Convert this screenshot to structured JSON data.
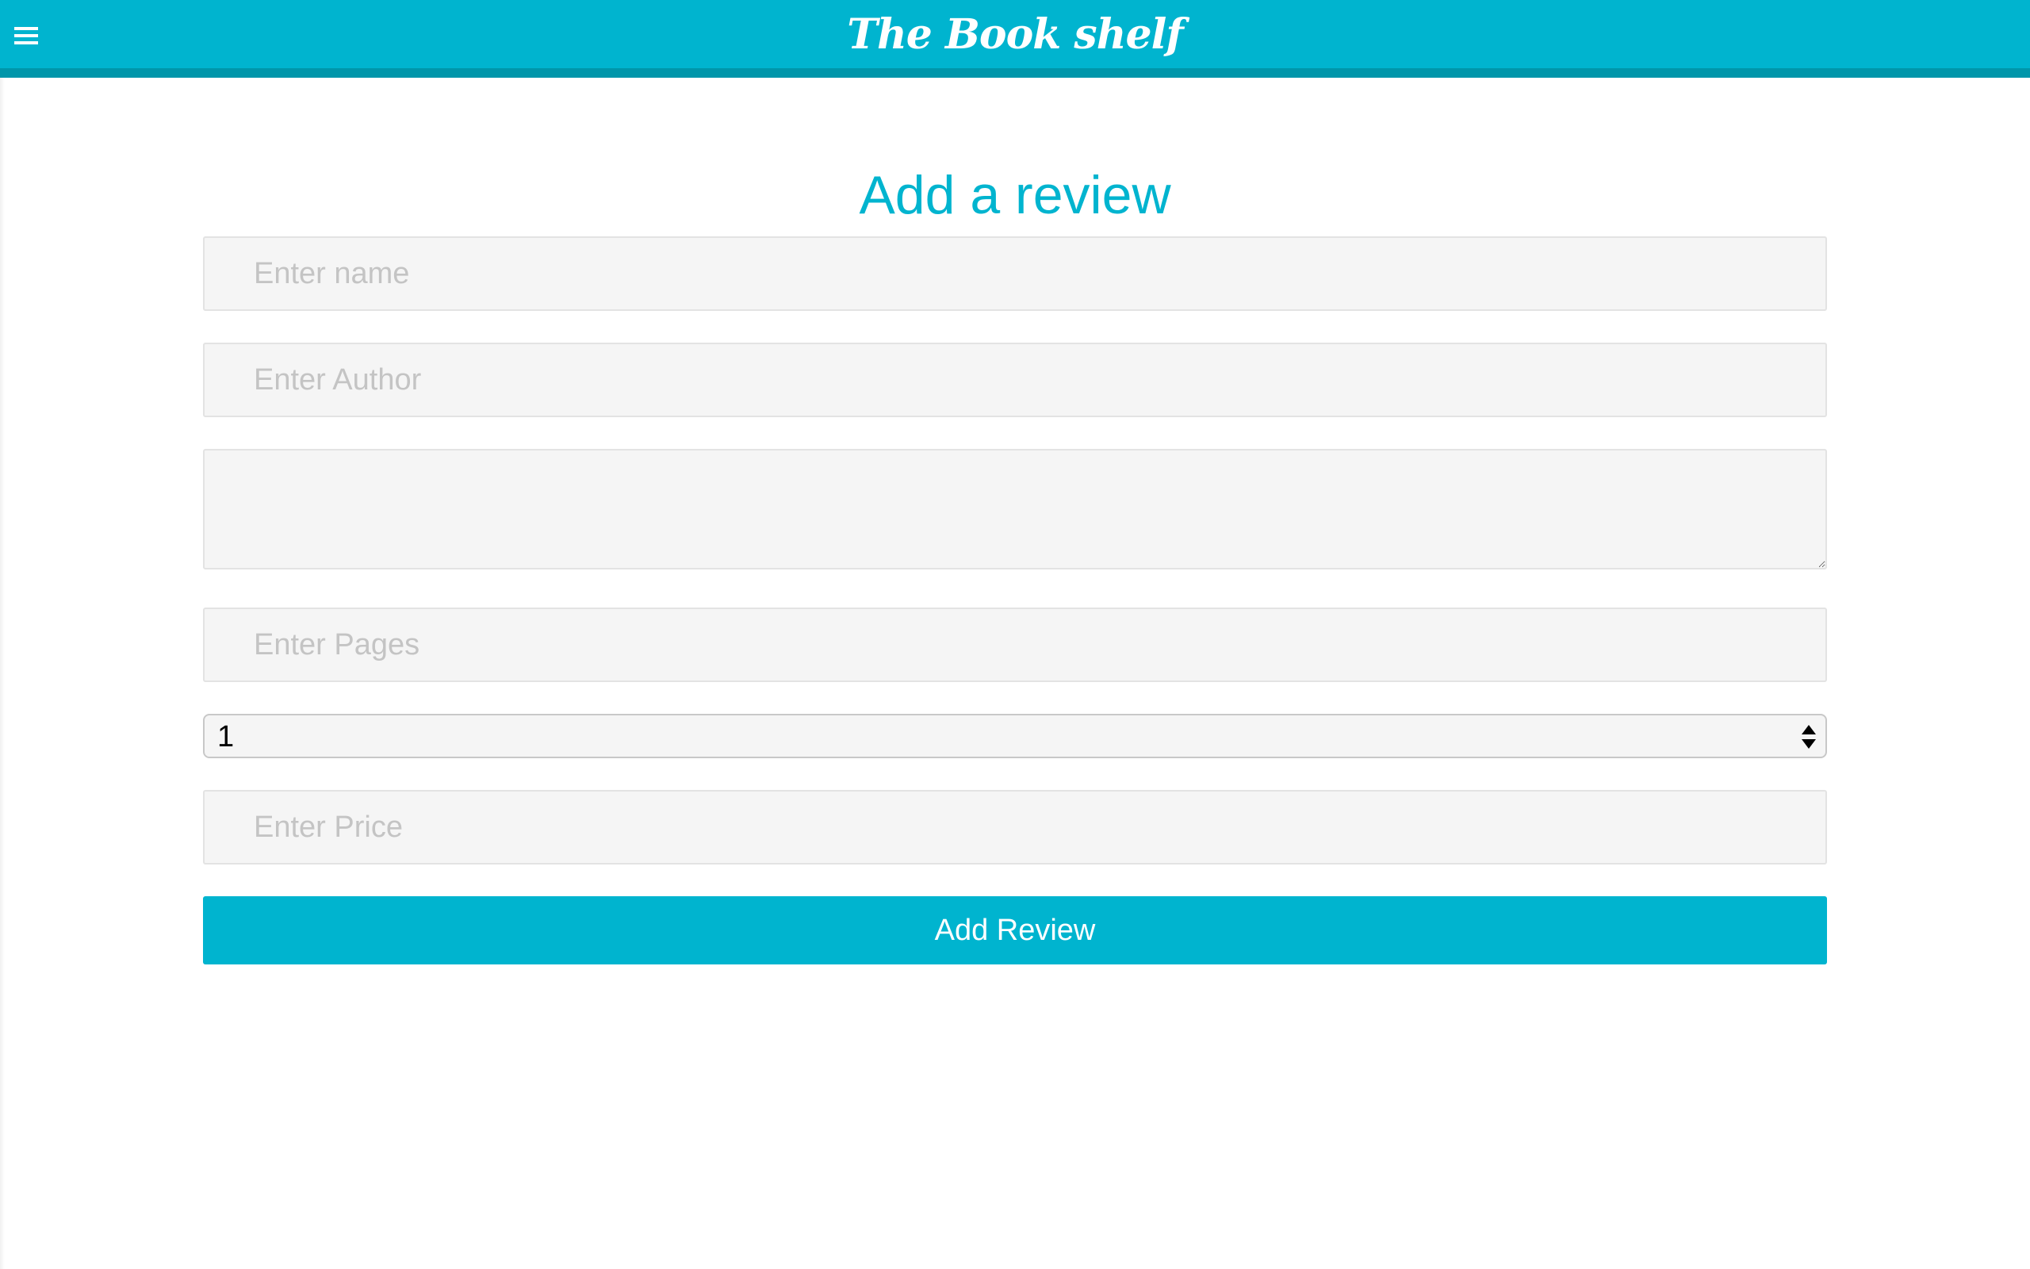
{
  "header": {
    "title": "The Book shelf",
    "menu_icon": "hamburger-menu-icon",
    "bg_color": "#00b4cf",
    "border_color": "#0096aa"
  },
  "main": {
    "title": "Add a review",
    "title_color": "#00b4cf"
  },
  "form": {
    "name": {
      "placeholder": "Enter name",
      "value": ""
    },
    "author": {
      "placeholder": "Enter Author",
      "value": ""
    },
    "review": {
      "placeholder": "",
      "value": ""
    },
    "pages": {
      "placeholder": "Enter Pages",
      "value": ""
    },
    "rating": {
      "selected": "1"
    },
    "price": {
      "placeholder": "Enter Price",
      "value": ""
    },
    "submit_label": "Add Review",
    "button_color": "#00b4cf"
  }
}
